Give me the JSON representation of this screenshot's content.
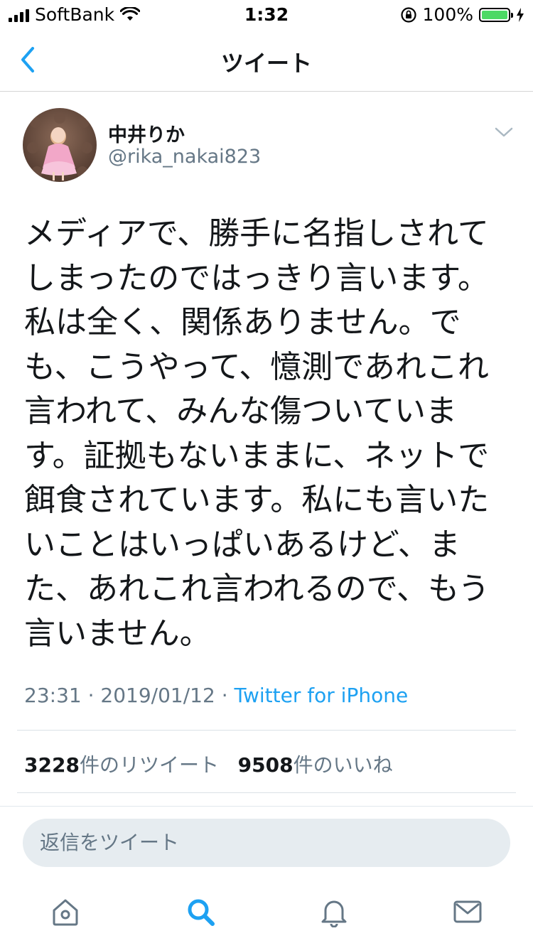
{
  "status_bar": {
    "carrier": "SoftBank",
    "time": "1:32",
    "battery_percent": "100%",
    "battery_level": 1.0
  },
  "nav": {
    "title": "ツイート",
    "back_icon": "chevron-left-icon"
  },
  "tweet": {
    "display_name": "中井りか",
    "handle": "@rika_nakai823",
    "text": "メディアで、勝手に名指しされて\nしまったのではっきり言います。\n私は全く、関係ありません。で\nも、こうやって、憶測であれこれ\n言われて、みんな傷ついていま\nす。証拠もないままに、ネットで\n餌食されています。私にも言いた\nいことはいっぱいあるけど、ま\nた、あれこれ言われるので、もう\n言いません。",
    "time": "23:31",
    "separator": "·",
    "date": "2019/01/12",
    "source": "Twitter for iPhone",
    "retweets_count": "3228",
    "retweets_label": "件のリツイート",
    "likes_count": "9508",
    "likes_label": "件のいいね"
  },
  "reply": {
    "placeholder": "返信をツイート"
  },
  "tabs": [
    {
      "icon": "home-icon"
    },
    {
      "icon": "search-icon",
      "active": true
    },
    {
      "icon": "notifications-icon"
    },
    {
      "icon": "messages-icon"
    }
  ],
  "colors": {
    "accent": "#1da1f2",
    "text": "#14171a",
    "secondary": "#657786",
    "battery": "#4cd964"
  }
}
